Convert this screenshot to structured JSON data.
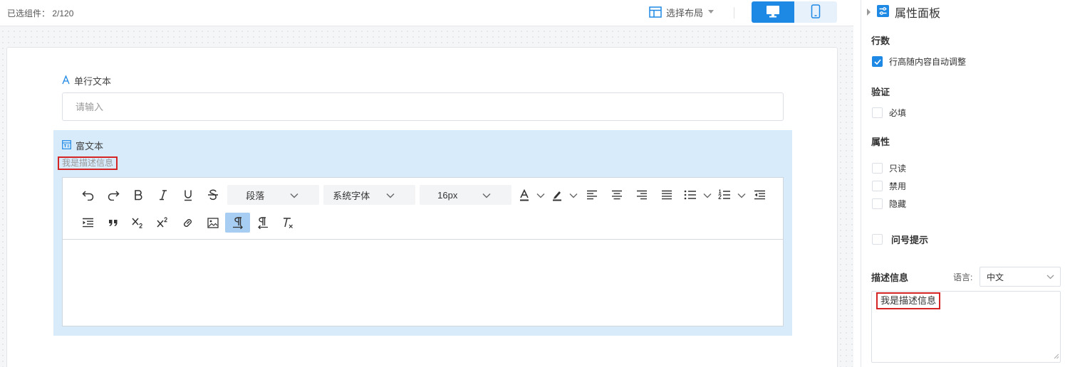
{
  "colors": {
    "accent": "#1e88e5",
    "selected_bg": "#d7ebfb",
    "highlight_border": "#d42424"
  },
  "topbar": {
    "selected_count": "已选组件： 2/120",
    "layout_select_label": "选择布局",
    "device_options": [
      "desktop-icon",
      "mobile-icon"
    ],
    "active_device": "desktop"
  },
  "form": {
    "single_text": {
      "label": "单行文本",
      "placeholder": "请输入",
      "icon": "text-a-icon"
    },
    "rich_text": {
      "label": "富文本",
      "icon": "rich-text-icon",
      "description": "我是描述信息",
      "toolbar": {
        "row1": [
          "undo-icon",
          "redo-icon",
          "bold-icon",
          "italic-icon",
          "underline-icon",
          "strikethrough-icon",
          "paragraph-select",
          "font-select",
          "size-select",
          "font-color-icon",
          "highlight-color-icon",
          "align-left-icon",
          "align-center-icon",
          "align-right-icon",
          "align-justify-icon",
          "bullet-list-icon",
          "numbered-list-icon",
          "outdent-icon"
        ],
        "row2": [
          "indent-icon",
          "blockquote-icon",
          "subscript-icon",
          "superscript-icon",
          "link-icon",
          "image-icon",
          "ltr-icon",
          "rtl-icon",
          "clear-format-icon"
        ],
        "paragraph_select": "段落",
        "font_select": "系统字体",
        "size_select": "16px",
        "active_button": "ltr-icon"
      }
    }
  },
  "panel": {
    "title": "属性面板",
    "sections": {
      "rows": {
        "title": "行数",
        "auto_height_label": "行高随内容自动调整",
        "auto_height_checked": true
      },
      "validation": {
        "title": "验证",
        "required_label": "必填",
        "required_checked": false
      },
      "attributes": {
        "title": "属性",
        "readonly_label": "只读",
        "disabled_label": "禁用",
        "hidden_label": "隐藏"
      },
      "tooltip": {
        "label": "问号提示",
        "checked": false
      },
      "description": {
        "title": "描述信息",
        "lang_label": "语言:",
        "lang_value": "中文",
        "text": "我是描述信息"
      }
    }
  }
}
